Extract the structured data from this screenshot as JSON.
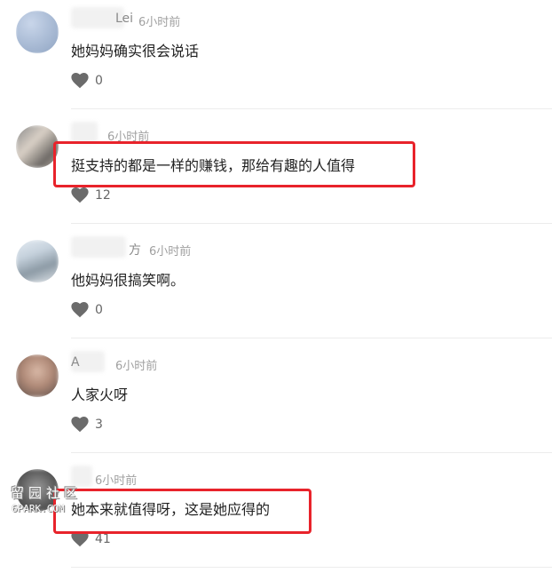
{
  "comments": [
    {
      "author": "Lei",
      "time": "6小时前",
      "text": "她妈妈确实很会说话",
      "likes": "0",
      "like_icon": "heart-icon",
      "highlighted": false
    },
    {
      "author": "",
      "time": "6小时前",
      "text": "挺支持的都是一样的赚钱，那给有趣的人值得",
      "likes": "12",
      "like_icon": "heart-icon",
      "highlighted": true
    },
    {
      "author": "方",
      "time": "6小时前",
      "text": "他妈妈很搞笑啊。",
      "likes": "0",
      "like_icon": "heart-icon",
      "highlighted": false
    },
    {
      "author": "A",
      "time": "6小时前",
      "text": "人家火呀",
      "likes": "3",
      "like_icon": "heart-icon",
      "highlighted": false
    },
    {
      "author": "",
      "time": "6小时前",
      "text": "她本来就值得呀，这是她应得的",
      "likes": "41",
      "like_icon": "heart-icon",
      "highlighted": true
    }
  ],
  "watermark": {
    "line1": "留园社区",
    "line2": "6PARK.COM"
  },
  "colors": {
    "highlight": "#e8232b",
    "like_icon": "#666666",
    "time_text": "#a0a0a0"
  }
}
